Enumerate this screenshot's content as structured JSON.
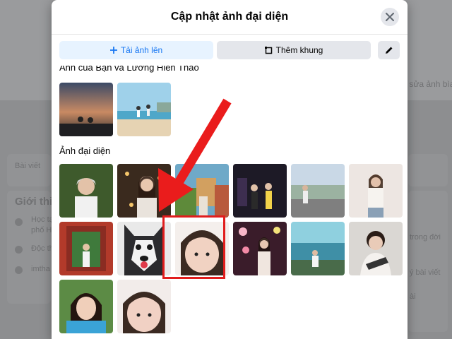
{
  "modal": {
    "title": "Cập nhật ảnh đại diện",
    "close_icon": "close-icon"
  },
  "toolbar": {
    "upload_label": "Tải ảnh lên",
    "frame_label": "Thêm khung",
    "edit_icon": "pencil-icon"
  },
  "sections": {
    "shared_label": "Ảnh của Bạn và Lương Hiền Thảo",
    "avatar_label": "Ảnh đại diện"
  },
  "background": {
    "tab_label": "Bài viết",
    "intro_heading": "Giới thi",
    "intro_line1": "Học tạ",
    "intro_line2": "phố H",
    "intro_line3": "Độc th",
    "intro_line4": "imtha",
    "edit_cover_label": "ỉnh sửa ảnh bìa",
    "right_line1": "trong đời",
    "right_line2": "ý bài viết",
    "right_line3": "ài"
  },
  "colors": {
    "accent": "#1877f2",
    "highlight": "#e11d1d"
  }
}
